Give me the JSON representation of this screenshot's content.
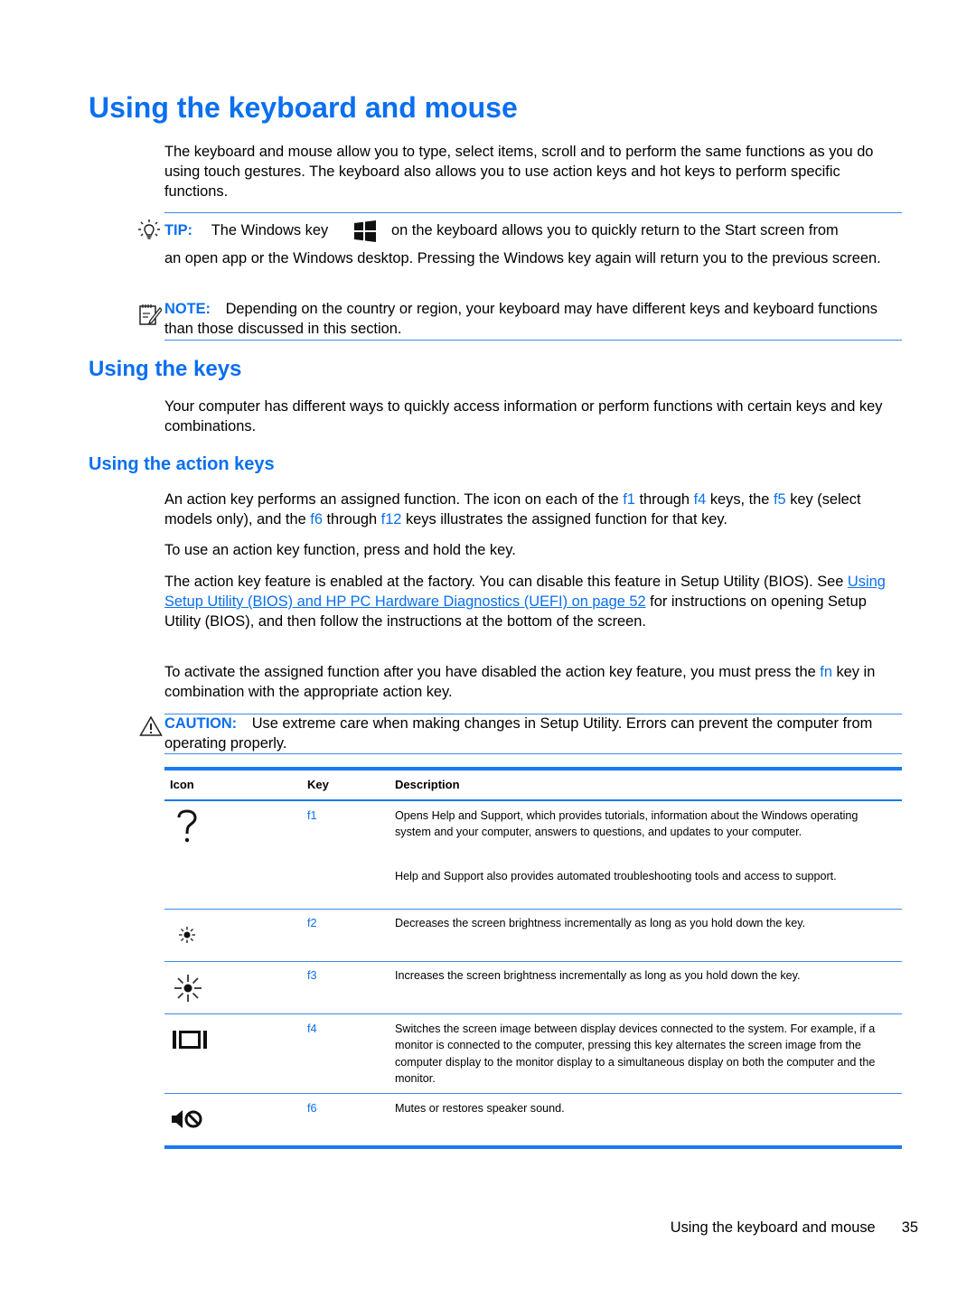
{
  "page": {
    "title": "Using the keyboard and mouse",
    "intro": "The keyboard and mouse allow you to type, select items, scroll and to perform the same functions as you do using touch gestures. The keyboard also allows you to use action keys and hot keys to perform specific functions.",
    "tip": {
      "label": "TIP:",
      "text_before_icon": "The Windows key",
      "text_after_icon": "on the keyboard allows you to quickly return to the Start screen from",
      "text_continued": "an open app or the Windows desktop. Pressing the Windows key again will return you to the previous screen.",
      "icon": "windows-key-icon"
    },
    "note": {
      "label": "NOTE:",
      "text": "Depending on the country or region, your keyboard may have different keys and keyboard functions than those discussed in this section."
    },
    "section_keys": {
      "title": "Using the keys",
      "text": "Your computer has different ways to quickly access information or perform functions with certain keys and key combinations."
    },
    "section_action_keys": {
      "title": "Using the action keys",
      "p1": {
        "a": "An action key performs an assigned function. The icon on each of the ",
        "k1": "f1",
        "b": " through ",
        "k2": "f4",
        "c": " keys, the ",
        "k3": "f5",
        "d": " key (select models only), and the ",
        "k4": "f6",
        "e": " through ",
        "k5": "f12",
        "f": " keys illustrates the assigned function for that key."
      },
      "p2": "To use an action key function, press and hold the key.",
      "p3": {
        "a": "The action key feature is enabled at the factory. You can disable this feature in Setup Utility (BIOS). See ",
        "link": "Using Setup Utility (BIOS) and HP PC Hardware Diagnostics (UEFI) on page 52",
        "b": " for instructions on opening Setup Utility (BIOS), and then follow the instructions at the bottom of the screen."
      },
      "p4": {
        "a": "To activate the assigned function after you have disabled the action key feature, you must press the ",
        "key": "fn",
        "b": " key in combination with the appropriate action key."
      },
      "caution": {
        "label": "CAUTION:",
        "text": "Use extreme care when making changes in Setup Utility. Errors can prevent the computer from operating properly."
      }
    },
    "table": {
      "headers": [
        "Icon",
        "Key",
        "Description"
      ],
      "rows": [
        {
          "icon": "help-question-icon",
          "key": "f1",
          "desc": [
            "Opens Help and Support, which provides tutorials, information about the Windows operating system and your computer, answers to questions, and updates to your computer.",
            "Help and Support also provides automated troubleshooting tools and access to support."
          ]
        },
        {
          "icon": "brightness-down-icon",
          "key": "f2",
          "desc": [
            "Decreases the screen brightness incrementally as long as you hold down the key."
          ]
        },
        {
          "icon": "brightness-up-icon",
          "key": "f3",
          "desc": [
            "Increases the screen brightness incrementally as long as you hold down the key."
          ]
        },
        {
          "icon": "display-switch-icon",
          "key": "f4",
          "desc": [
            "Switches the screen image between display devices connected to the system. For example, if a monitor is connected to the computer, pressing this key alternates the screen image from the computer display to the monitor display to a simultaneous display on both the computer and the monitor."
          ]
        },
        {
          "icon": "mute-icon",
          "key": "f6",
          "desc": [
            "Mutes or restores speaker sound."
          ]
        }
      ]
    },
    "footer": {
      "section": "Using the keyboard and mouse",
      "page_number": "35"
    },
    "colors": {
      "accent": "#0a6ff0"
    }
  }
}
